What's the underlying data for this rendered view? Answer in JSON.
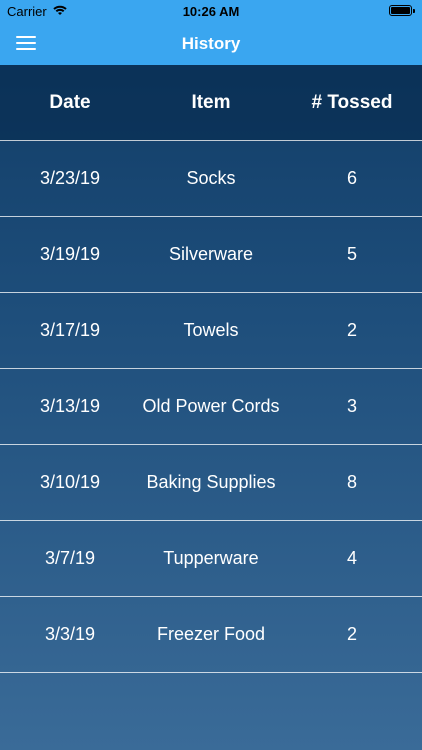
{
  "status_bar": {
    "carrier": "Carrier",
    "time": "10:26 AM"
  },
  "nav": {
    "title": "History"
  },
  "table": {
    "headers": [
      "Date",
      "Item",
      "# Tossed"
    ],
    "rows": [
      [
        "3/23/19",
        "Socks",
        "6"
      ],
      [
        "3/19/19",
        "Silverware",
        "5"
      ],
      [
        "3/17/19",
        "Towels",
        "2"
      ],
      [
        "3/13/19",
        "Old Power Cords",
        "3"
      ],
      [
        "3/10/19",
        "Baking Supplies",
        "8"
      ],
      [
        "3/7/19",
        "Tupperware",
        "4"
      ],
      [
        "3/3/19",
        "Freezer Food",
        "2"
      ]
    ]
  },
  "colors": {
    "accent": "#3aa6f0",
    "background_top": "#0f3a63",
    "background_bottom": "#3a6b98"
  },
  "icons": {
    "menu": "hamburger-menu-icon",
    "wifi": "wifi-icon",
    "battery": "battery-icon"
  }
}
